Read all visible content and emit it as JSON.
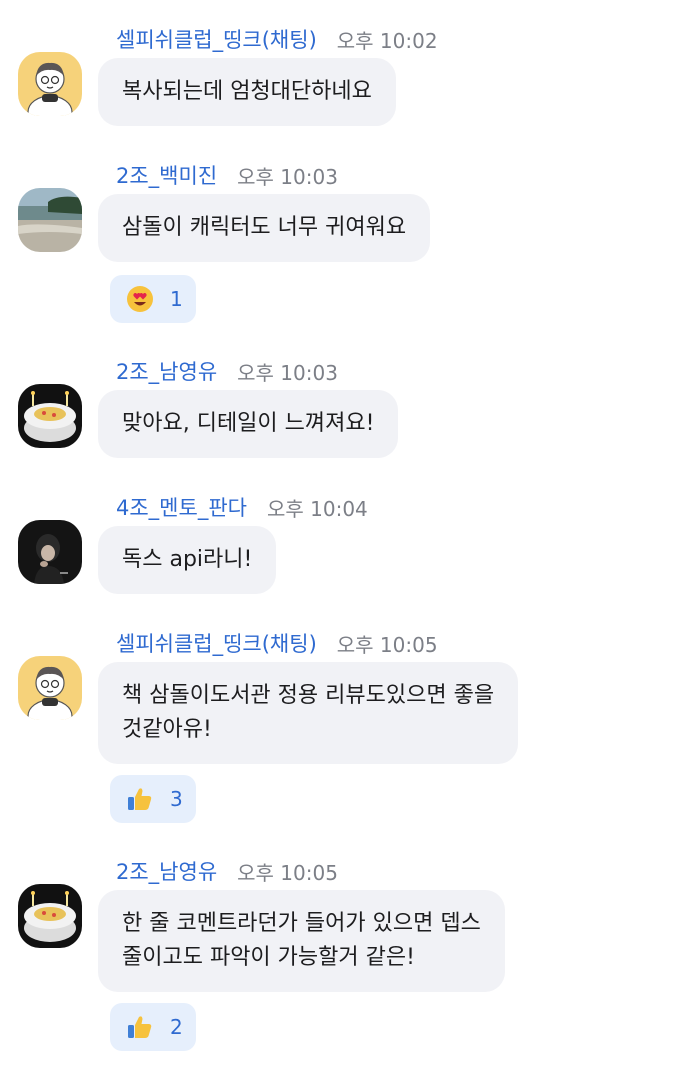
{
  "messages": [
    {
      "sender": "셀피쉬클럽_띵크(채팅)",
      "time": "오후 10:02",
      "avatar": "boy-character-avatar",
      "text": "복사되는데 엄청대단하네요",
      "reaction": null
    },
    {
      "sender": "2조_백미진",
      "time": "오후 10:03",
      "avatar": "beach-photo-avatar",
      "text": "삼돌이 캐릭터도 너무 귀여워요",
      "reaction": {
        "emoji": "heart-eyes-icon",
        "count": "1"
      }
    },
    {
      "sender": "2조_남영유",
      "time": "오후 10:03",
      "avatar": "cake-photo-avatar",
      "text": "맞아요, 디테일이 느껴져요!",
      "reaction": null
    },
    {
      "sender": "4조_멘토_판다",
      "time": "오후 10:04",
      "avatar": "dark-portrait-avatar",
      "text": "독스 api라니!",
      "reaction": null
    },
    {
      "sender": "셀피쉬클럽_띵크(채팅)",
      "time": "오후 10:05",
      "avatar": "boy-character-avatar",
      "text": "책 삼돌이도서관 정용 리뷰도있으면 좋을\n것같아유!",
      "reaction": {
        "emoji": "thumbs-up-icon",
        "count": "3"
      }
    },
    {
      "sender": "2조_남영유",
      "time": "오후 10:05",
      "avatar": "cake-photo-avatar",
      "text": "한 줄 코멘트라던가 들어가 있으면 뎁스\n줄이고도 파악이 가능할거 같은!",
      "reaction": {
        "emoji": "thumbs-up-icon",
        "count": "2"
      }
    }
  ]
}
